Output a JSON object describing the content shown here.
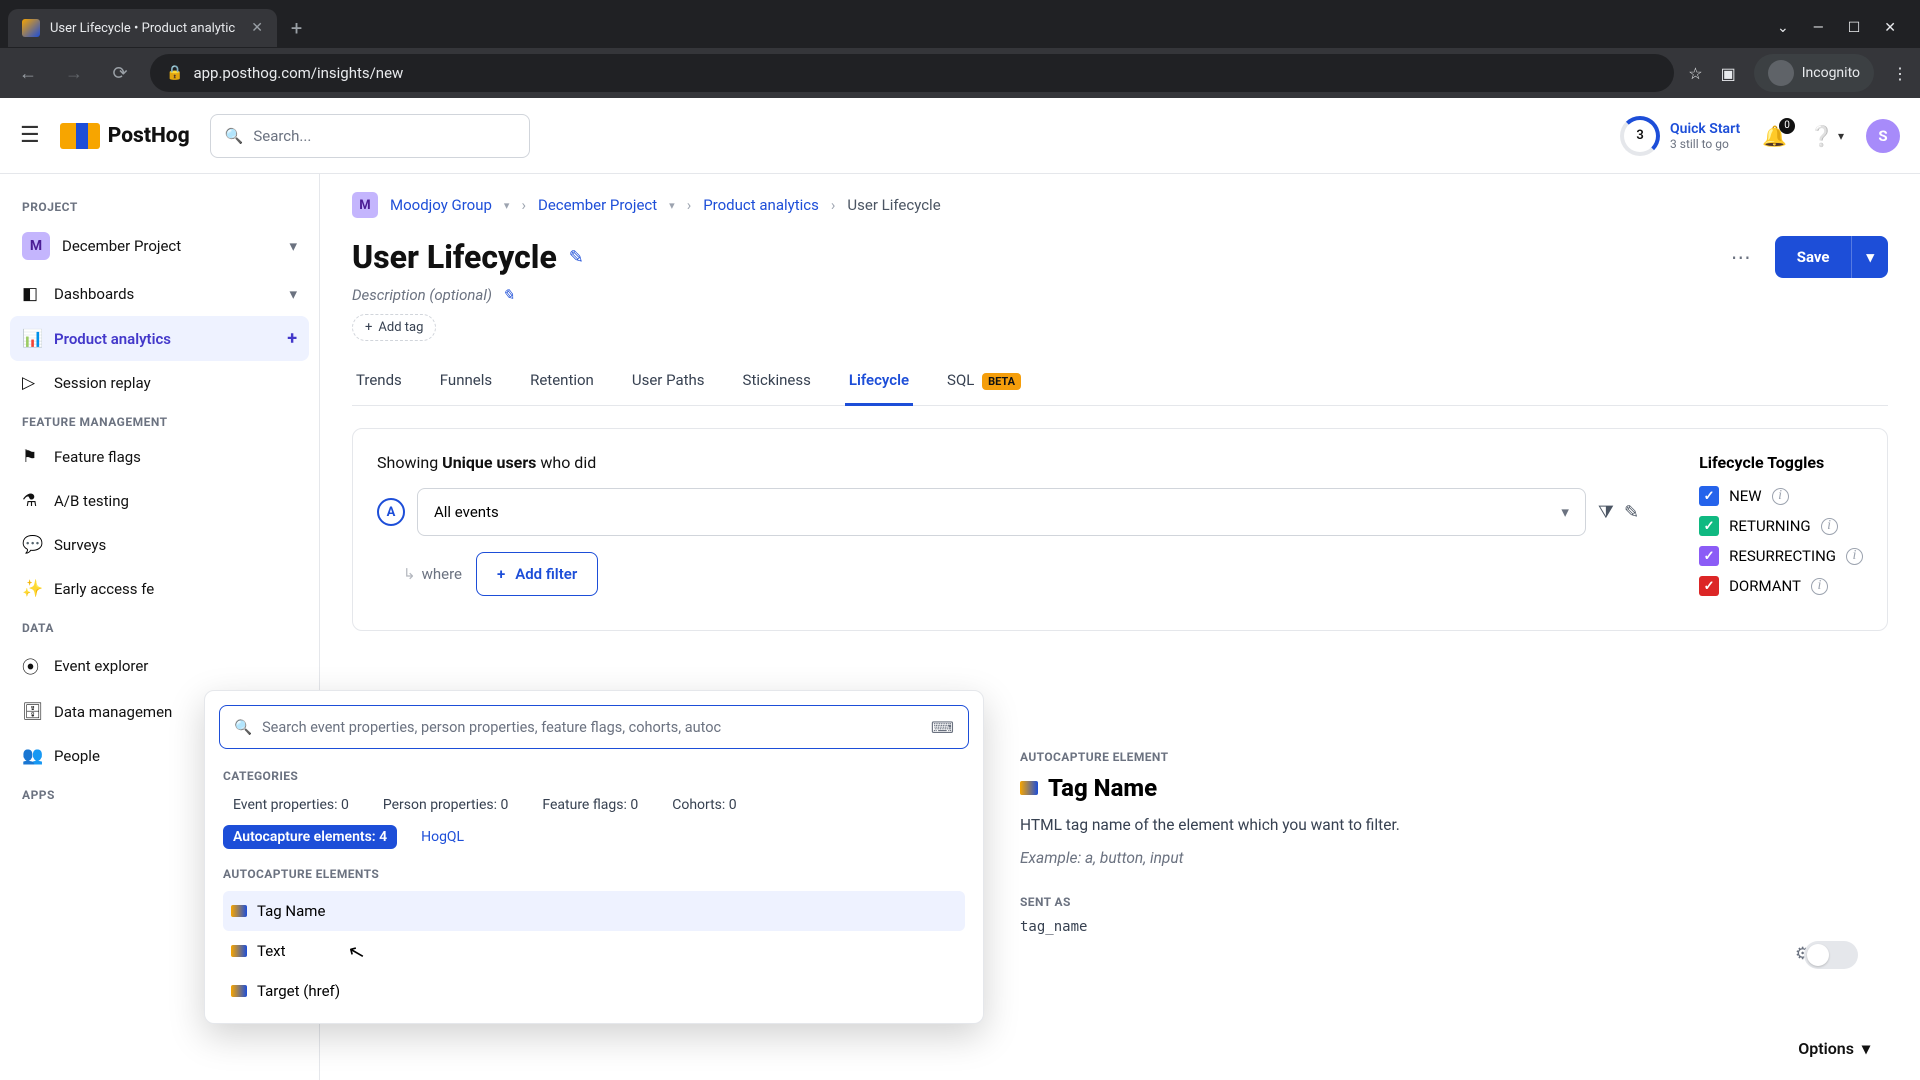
{
  "browser": {
    "tab_title": "User Lifecycle • Product analytic",
    "url": "app.posthog.com/insights/new",
    "incognito_label": "Incognito"
  },
  "topbar": {
    "logo": "PostHog",
    "search_placeholder": "Search...",
    "quickstart": {
      "count": "3",
      "title": "Quick Start",
      "subtitle": "3 still to go"
    },
    "notif_count": "0",
    "user_initial": "S"
  },
  "sidebar": {
    "project_label": "PROJECT",
    "project_name": "December Project",
    "project_initial": "M",
    "items": {
      "dashboards": "Dashboards",
      "product_analytics": "Product analytics",
      "session_replay": "Session replay"
    },
    "feature_label": "FEATURE MANAGEMENT",
    "feature_items": {
      "flags": "Feature flags",
      "ab": "A/B testing",
      "surveys": "Surveys",
      "early": "Early access fe"
    },
    "data_label": "DATA",
    "data_items": {
      "explorer": "Event explorer",
      "mgmt": "Data managemen",
      "people": "People"
    },
    "apps_label": "APPS"
  },
  "breadcrumb": {
    "org_initial": "M",
    "org": "Moodjoy Group",
    "project": "December Project",
    "area": "Product analytics",
    "page": "User Lifecycle"
  },
  "page": {
    "title": "User Lifecycle",
    "description": "Description (optional)",
    "add_tag": "Add tag",
    "save": "Save"
  },
  "tabs": {
    "trends": "Trends",
    "funnels": "Funnels",
    "retention": "Retention",
    "paths": "User Paths",
    "stickiness": "Stickiness",
    "lifecycle": "Lifecycle",
    "sql": "SQL",
    "beta": "BETA"
  },
  "config": {
    "showing_prefix": "Showing ",
    "showing_bold": "Unique users",
    "showing_suffix": " who did",
    "event_selected": "All events",
    "where": "where",
    "add_filter": "Add filter",
    "toggles_title": "Lifecycle Toggles",
    "toggles": {
      "new": "NEW",
      "returning": "RETURNING",
      "resurrecting": "RESURRECTING",
      "dormant": "DORMANT"
    }
  },
  "popover": {
    "search_placeholder": "Search event properties, person properties, feature flags, cohorts, autoc",
    "categories_label": "CATEGORIES",
    "cats": {
      "event": "Event properties: 0",
      "person": "Person properties: 0",
      "flags": "Feature flags: 0",
      "cohorts": "Cohorts: 0",
      "auto": "Autocapture elements: 4",
      "hogql": "HogQL"
    },
    "section_label": "AUTOCAPTURE ELEMENTS",
    "items": {
      "tag": "Tag Name",
      "text": "Text",
      "target": "Target (href)"
    }
  },
  "detail": {
    "label": "AUTOCAPTURE ELEMENT",
    "title": "Tag Name",
    "desc": "HTML tag name of the element which you want to filter.",
    "example": "Example: a, button, input",
    "sent_as_label": "SENT AS",
    "sent_as": "tag_name"
  },
  "options_label": "Options"
}
